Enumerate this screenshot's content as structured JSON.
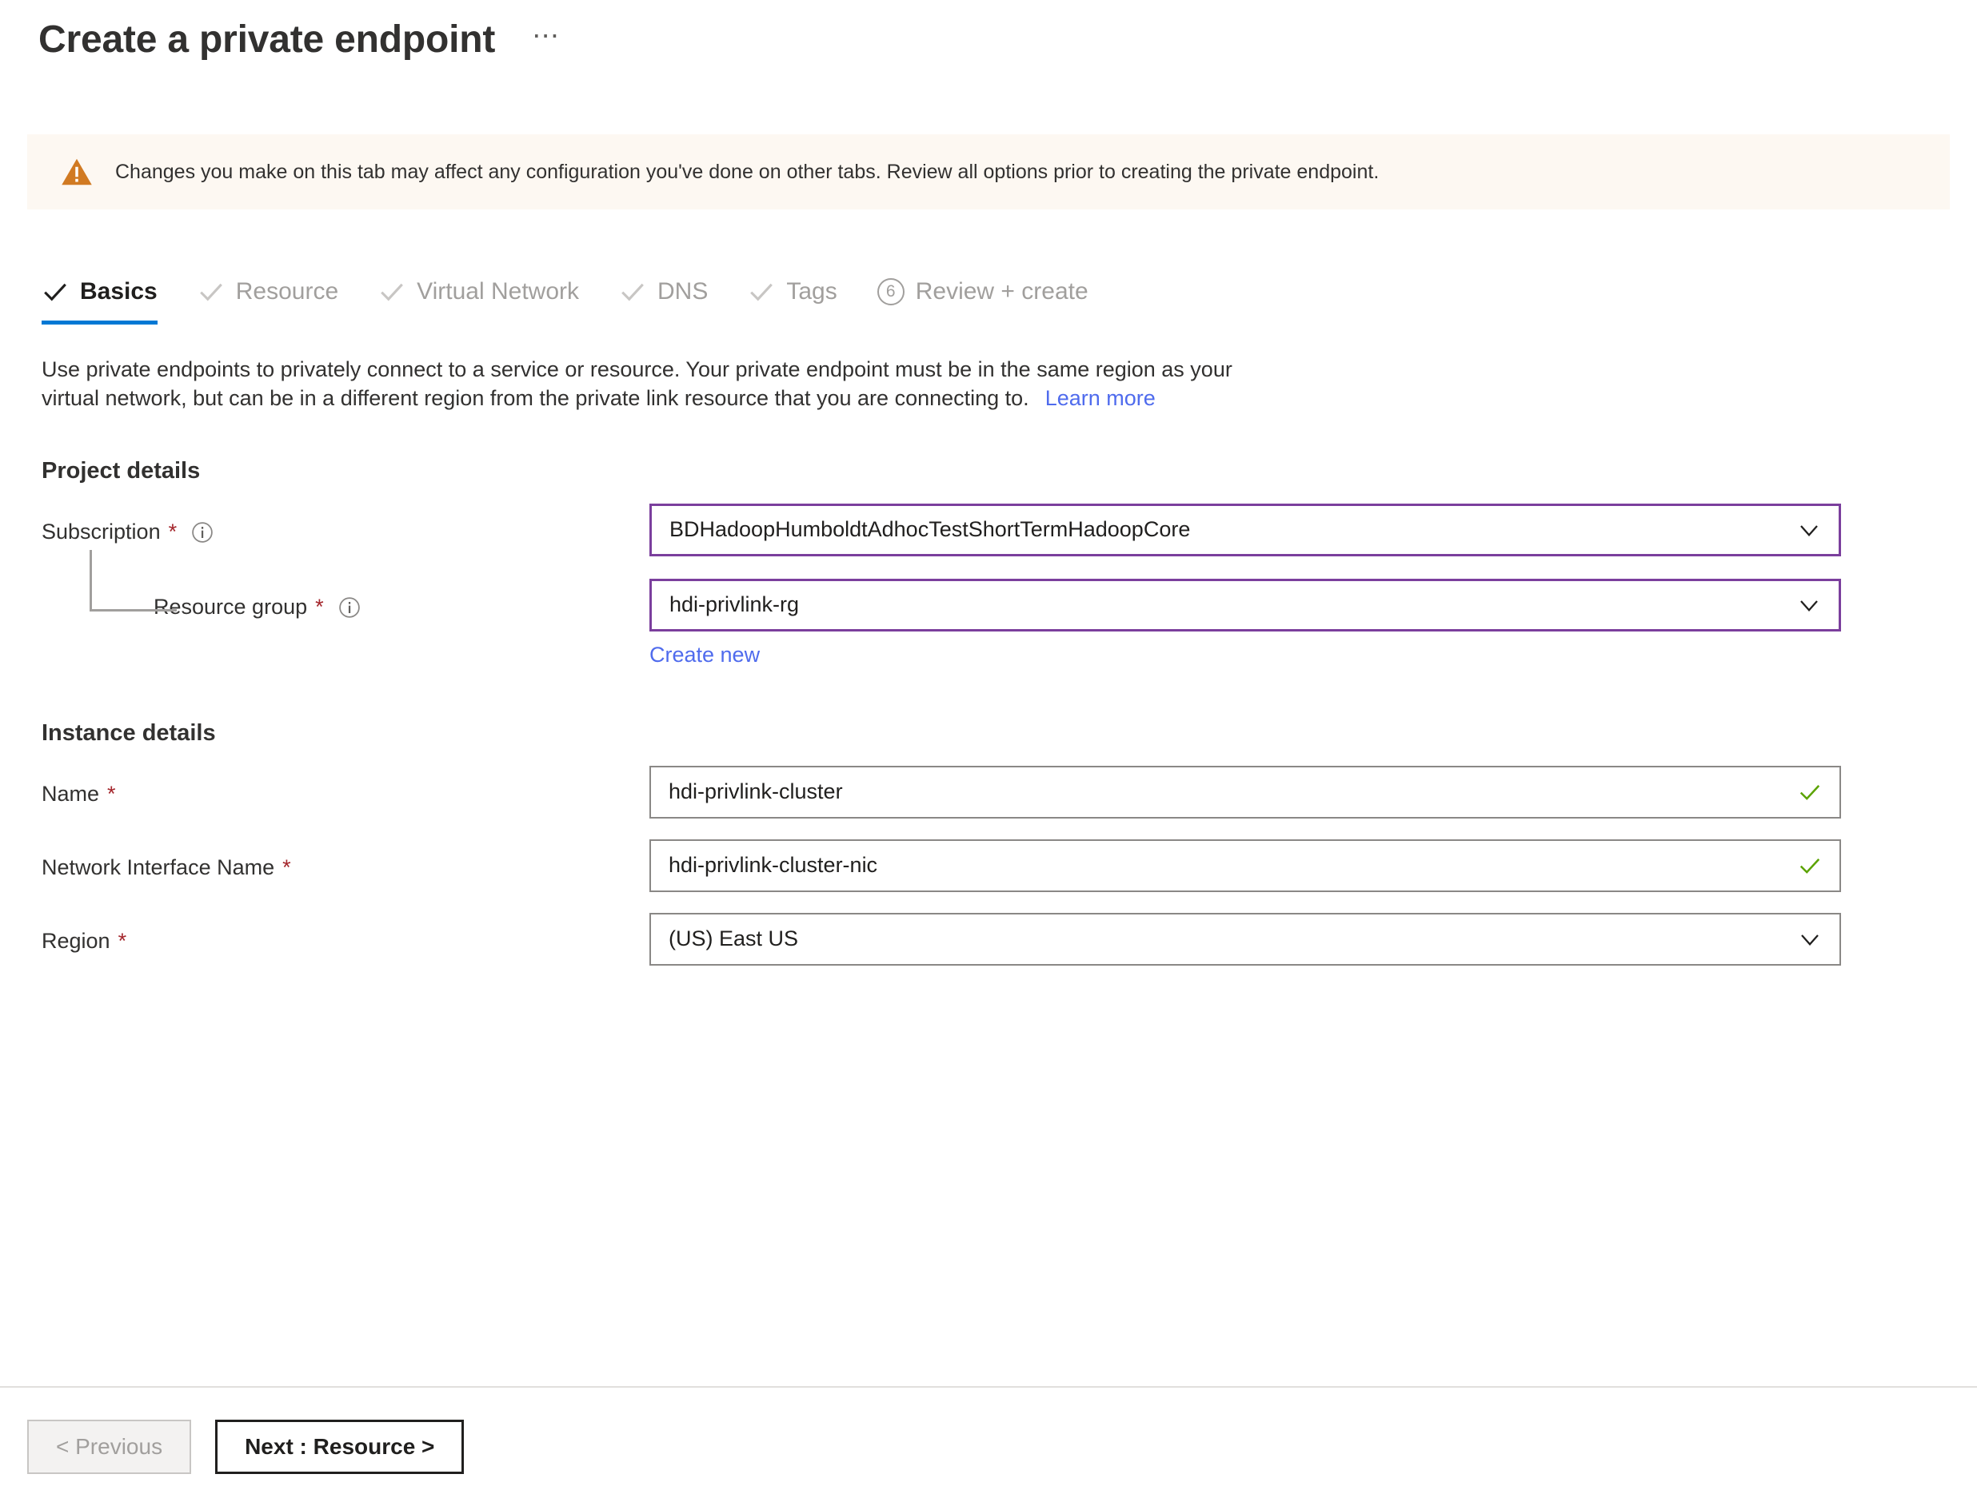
{
  "header": {
    "title": "Create a private endpoint",
    "more_label": "⋯"
  },
  "banner": {
    "icon": "warning-triangle-icon",
    "text": "Changes you make on this tab may affect any configuration you've done on other tabs. Review all options prior to creating the private endpoint."
  },
  "tabs": [
    {
      "label": "Basics",
      "marker": "check",
      "active": true
    },
    {
      "label": "Resource",
      "marker": "check",
      "active": false
    },
    {
      "label": "Virtual Network",
      "marker": "check",
      "active": false
    },
    {
      "label": "DNS",
      "marker": "check",
      "active": false
    },
    {
      "label": "Tags",
      "marker": "check",
      "active": false
    },
    {
      "label": "Review + create",
      "marker": "6",
      "active": false
    }
  ],
  "description": {
    "line1": "Use private endpoints to privately connect to a service or resource. Your private endpoint must be in the same region as your",
    "line2": "virtual network, but can be in a different region from the private link resource that you are connecting to.",
    "learn_more": "Learn more"
  },
  "project_details": {
    "heading": "Project details",
    "subscription": {
      "label": "Subscription",
      "required": "*",
      "value": "BDHadoopHumboldtAdhocTestShortTermHadoopCore"
    },
    "resource_group": {
      "label": "Resource group",
      "required": "*",
      "value": "hdi-privlink-rg",
      "create_new": "Create new"
    }
  },
  "instance_details": {
    "heading": "Instance details",
    "name": {
      "label": "Name",
      "required": "*",
      "value": "hdi-privlink-cluster"
    },
    "nic_name": {
      "label": "Network Interface Name",
      "required": "*",
      "value": "hdi-privlink-cluster-nic"
    },
    "region": {
      "label": "Region",
      "required": "*",
      "value": "(US) East US"
    }
  },
  "footer": {
    "previous": "< Previous",
    "next": "Next : Resource >"
  },
  "colors": {
    "accent": "#0078d4",
    "link": "#4f6bed",
    "warning": "#d17a22",
    "banner_bg": "#fdf8f2",
    "required_star": "#a4262c",
    "focus_border": "#7b3f9d",
    "valid_check": "#5ba300"
  }
}
